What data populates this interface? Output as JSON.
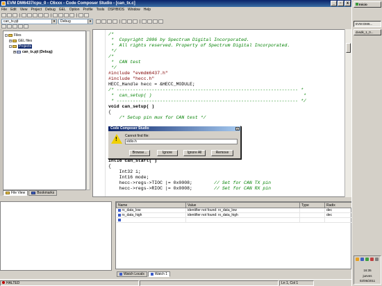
{
  "window": {
    "title": "EVM DM6437/cpu_0 - C6xxx - Code Composer Studio - [can_tx.c]",
    "controls": [
      "_",
      "▫",
      "x"
    ]
  },
  "menu": [
    "File",
    "Edit",
    "View",
    "Project",
    "Debug",
    "GEL",
    "Option",
    "Profile",
    "Tools",
    "DSP/BIOS",
    "Window",
    "Help"
  ],
  "toolbar": {
    "project_combo": "can_tx.pjt",
    "config_combo": "Debug"
  },
  "tree": {
    "root": "Files",
    "gel": "GEL files",
    "projects": "Projects",
    "project": "can_tx.pjt (Debug)"
  },
  "left_tabs": [
    "File View",
    "Bookmarks"
  ],
  "editor": {
    "lines": [
      {
        "cls": "cmt",
        "text": "/*"
      },
      {
        "cls": "cmt",
        "text": " *  Copyright 2006 by Spectrum Digital Incorporated."
      },
      {
        "cls": "cmt",
        "text": " *  All rights reserved. Property of Spectrum Digital Incorporated."
      },
      {
        "cls": "cmt",
        "text": " */"
      },
      {
        "cls": "",
        "text": ""
      },
      {
        "cls": "cmt",
        "text": "/*"
      },
      {
        "cls": "cmt",
        "text": " *  CAN test"
      },
      {
        "cls": "cmt",
        "text": " */"
      },
      {
        "cls": "",
        "text": ""
      },
      {
        "cls": "pp",
        "text": "#include \"evmdm6437.h\""
      },
      {
        "cls": "pp",
        "text": "#include \"hecc.h\""
      },
      {
        "cls": "",
        "text": ""
      },
      {
        "cls": "",
        "text": "HECC_Handle hecc = &HECC_MODULE;"
      },
      {
        "cls": "",
        "text": ""
      },
      {
        "cls": "cmt",
        "text": "/* ------------------------------------------------------------------- *"
      },
      {
        "cls": "cmt",
        "text": " *  can_setup( )                                                        *"
      },
      {
        "cls": "cmt",
        "text": " * ------------------------------------------------------------------- */"
      },
      {
        "cls": "kw",
        "text": "void can_setup( )"
      },
      {
        "cls": "",
        "text": "{"
      },
      {
        "cls": "cmt",
        "text": "    /* Setup pin mux for CAN test */"
      }
    ],
    "lines2": [
      {
        "cls": "kw",
        "text": "Int16 can_start( )"
      },
      {
        "cls": "",
        "text": "{"
      },
      {
        "cls": "",
        "text": "    Int32 i;"
      },
      {
        "cls": "",
        "text": "    Int16 mode;"
      },
      {
        "cls": "",
        "text": ""
      },
      {
        "cls": "mix",
        "text": "    hecc->regs->TIOC |= 0x0008;",
        "comment": "// Set for CAN TX pin"
      },
      {
        "cls": "mix",
        "text": "    hecc->regs->RIOC |= 0x0008;",
        "comment": "// Set for CAN RX pin"
      }
    ]
  },
  "dialog": {
    "title": "Code Composer Studio",
    "message1": "Cannot find file:",
    "message2": "stdio.h",
    "buttons": [
      "Browse...",
      "Ignore",
      "Ignore All",
      "Remove"
    ]
  },
  "watch": {
    "columns": [
      "Name",
      "Value",
      "Type",
      "Radix"
    ],
    "rows": [
      {
        "name": "rx_data_low",
        "value": "identifier not found: rx_data_low",
        "type": "",
        "radix": "dec"
      },
      {
        "name": "rx_data_high",
        "value": "identifier not found: rx_data_high",
        "type": "",
        "radix": "dec"
      },
      {
        "name": "",
        "value": "",
        "type": "",
        "radix": ""
      }
    ],
    "tabs": [
      "Watch Locals",
      "Watch 1"
    ]
  },
  "status": {
    "state": "HALTED",
    "position": "Ln 1, Col 1"
  },
  "taskbar": {
    "start": "Inicio",
    "items": [
      "EVM DM6...",
      "dvsdk_1_0..."
    ],
    "clock_time": "16:35",
    "clock_day": "jueves",
    "clock_date": "02/06/2011"
  }
}
